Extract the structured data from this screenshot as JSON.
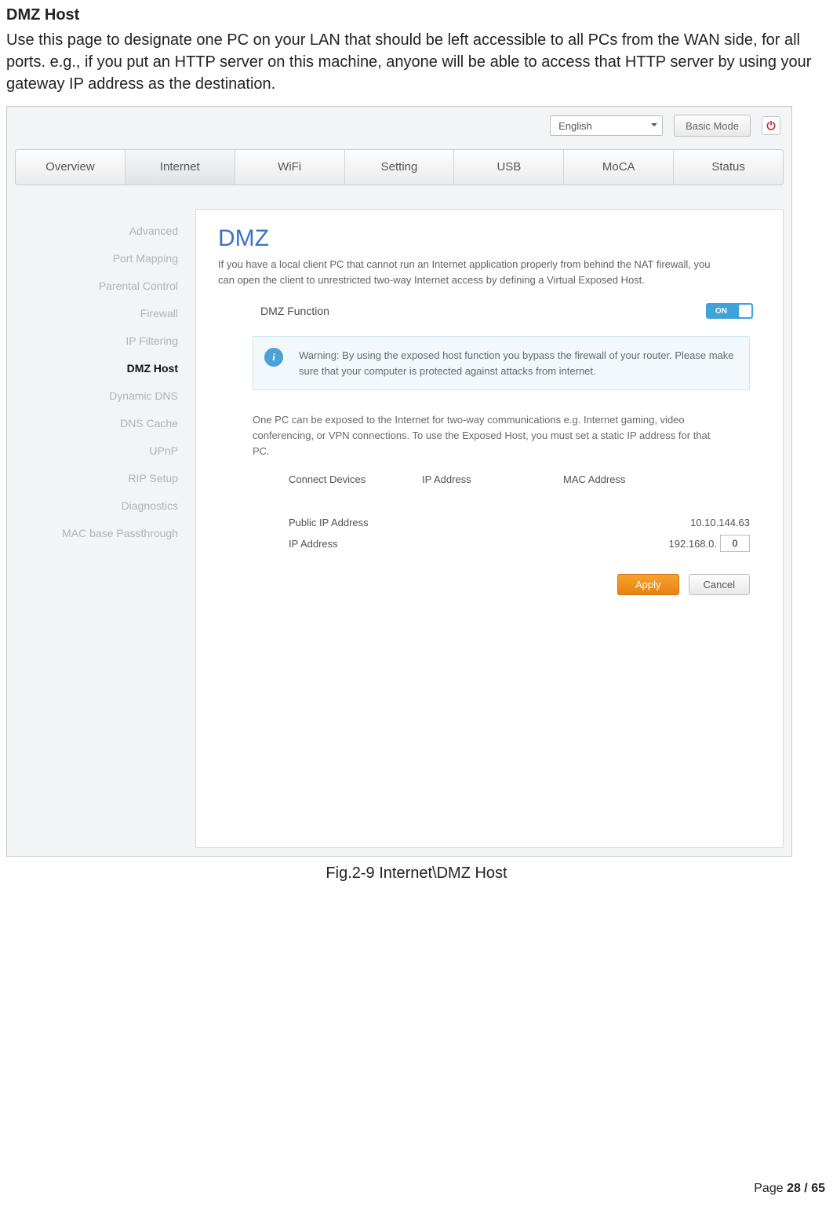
{
  "doc": {
    "title": "DMZ Host",
    "intro": "Use this page to designate one PC on your LAN that should be left accessible to all PCs from the WAN side, for all ports. e.g., if you put an HTTP server on this machine, anyone will be able to access that HTTP server by using your gateway IP address as the destination.",
    "fig_caption": "Fig.2-9 Internet\\DMZ Host",
    "footer_prefix": "Page ",
    "footer_page_current": "28",
    "footer_page_sep": " / ",
    "footer_page_total": "65"
  },
  "ui": {
    "topright": {
      "language_selected": "English",
      "mode_button": "Basic Mode"
    },
    "tabs": [
      "Overview",
      "Internet",
      "WiFi",
      "Setting",
      "USB",
      "MoCA",
      "Status"
    ],
    "tabs_active_index": 1,
    "leftnav": [
      "Advanced",
      "Port Mapping",
      "Parental Control",
      "Firewall",
      "IP Filtering",
      "DMZ Host",
      "Dynamic DNS",
      "DNS Cache",
      "UPnP",
      "RIP Setup",
      "Diagnostics",
      "MAC base Passthrough"
    ],
    "leftnav_active_index": 5,
    "panel": {
      "title": "DMZ",
      "description": "If you have a local client PC that cannot run an Internet application properly from behind the NAT firewall, you can open the client to unrestricted two-way Internet access by defining a Virtual Exposed Host.",
      "function_label": "DMZ Function",
      "switch_state": "ON",
      "warning": "Warning: By using the exposed host function you bypass the firewall of your router. Please make sure that your computer is protected against attacks from internet.",
      "mid_text": "One PC can be exposed to the Internet for two-way communications e.g. Internet gaming, video conferencing, or VPN connections. To use the Exposed Host, you must set a static IP address for that PC.",
      "table_headers": {
        "c1": "Connect Devices",
        "c2": "IP Address",
        "c3": "MAC Address"
      },
      "public_ip_label": "Public IP Address",
      "public_ip_value": "10.10.144.63",
      "ip_label": "IP Address",
      "ip_prefix": "192.168.0.",
      "ip_last_octet": "0",
      "apply_label": "Apply",
      "cancel_label": "Cancel"
    }
  }
}
